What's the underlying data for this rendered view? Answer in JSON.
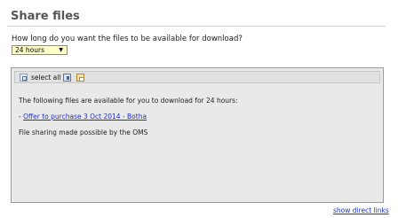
{
  "panel": {
    "title": "Share files"
  },
  "question": "How long do you want the files to be available for download?",
  "duration": {
    "selected": "24 hours"
  },
  "toolbar": {
    "select_all_label": "select all"
  },
  "files_panel": {
    "intro": "The following files are available for you to download for 24 hours:",
    "file_prefix": "- ",
    "file_link": "Offer to purchase 3 Oct 2014 - Botha",
    "footer_note": "File sharing made possible by the OMS"
  },
  "show_direct_links": "show direct links"
}
